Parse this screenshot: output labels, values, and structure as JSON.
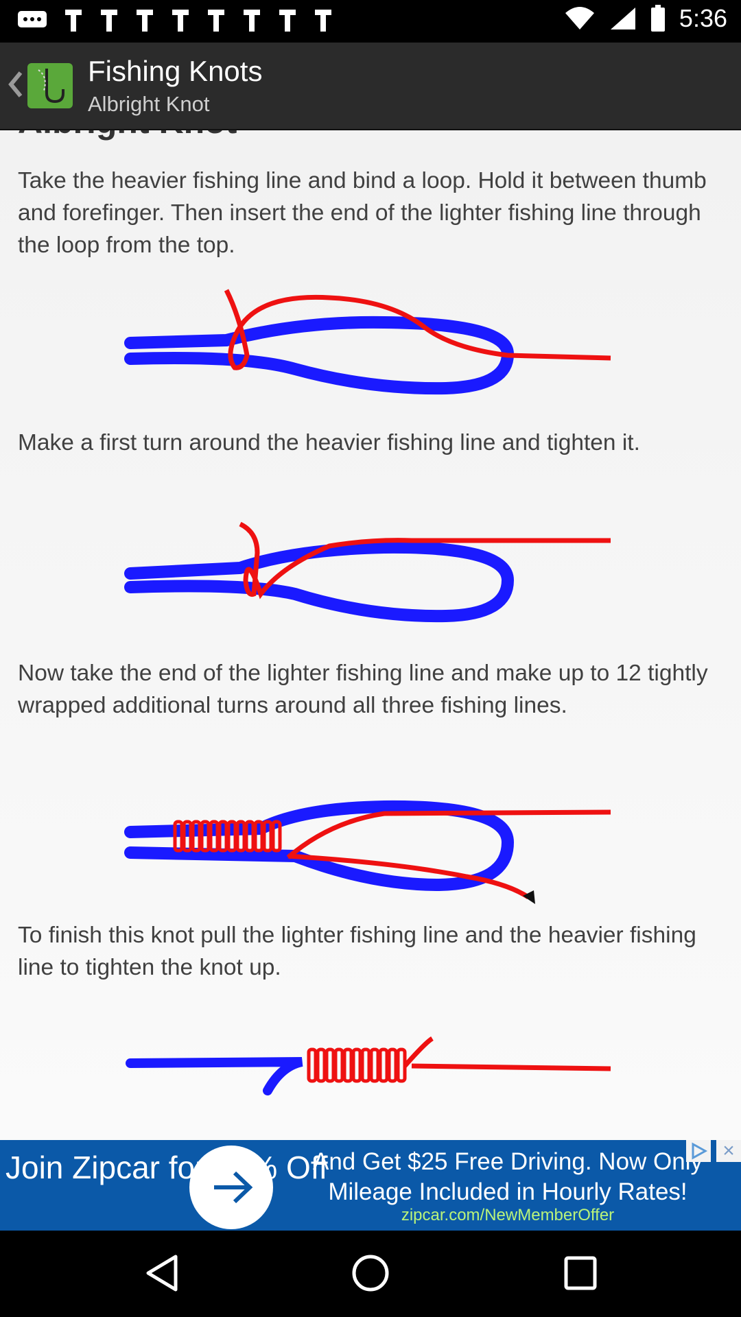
{
  "status_bar": {
    "time": "5:36"
  },
  "app_bar": {
    "title": "Fishing Knots",
    "subtitle": "Albright Knot"
  },
  "content": {
    "heading": "Albright Knot",
    "steps": [
      {
        "text": "Take the heavier fishing line and bind a loop. Hold it between thumb and forefinger. Then insert the end of the lighter fishing line through the loop from the top."
      },
      {
        "text": "Make a first turn around the heavier fishing line and tighten it."
      },
      {
        "text": "Now take the end of the lighter fishing line and make up to 12 tightly wrapped additional turns around all three fishing lines."
      },
      {
        "text": "To finish this knot pull the lighter fishing line and the heavier fishing line to tighten the knot up."
      }
    ]
  },
  "ad": {
    "left_text": "Join Zipcar for 50% Off",
    "right_text": "And Get $25 Free Driving. Now Only Mileage Included in Hourly Rates!",
    "url": "zipcar.com/NewMemberOffer"
  },
  "colors": {
    "heavy_line": "#1a1aff",
    "light_line": "#ee1111",
    "ad_background": "#0b59a8",
    "ad_url": "#b9f37a"
  },
  "icons": {
    "back": "chevron-left-icon",
    "app": "fishing-hook-icon",
    "nav_back": "triangle-back-icon",
    "nav_home": "circle-home-icon",
    "nav_recents": "square-recents-icon"
  }
}
